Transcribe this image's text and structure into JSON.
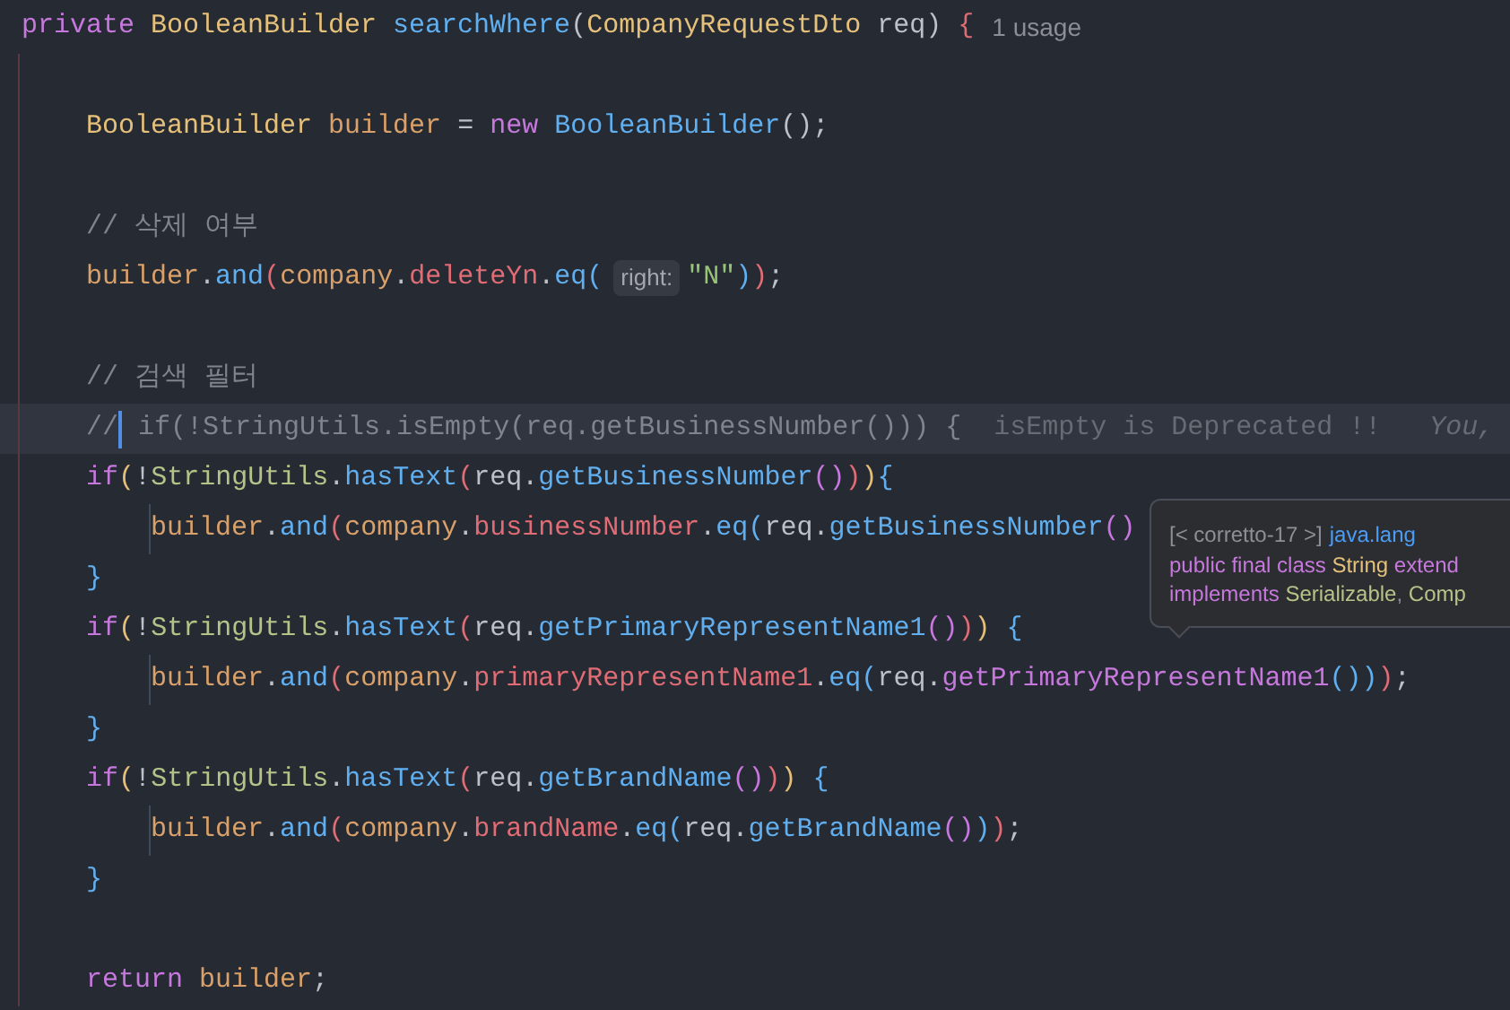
{
  "editor": {
    "lines": [
      {
        "kind": "code",
        "current": false,
        "parts": [
          {
            "kind": "code",
            "tokens": [
              {
                "text": "private ",
                "kind": "kw"
              },
              {
                "text": "BooleanBuilder ",
                "kind": "type"
              },
              {
                "text": "searchWhere",
                "kind": "fn"
              },
              {
                "text": "(",
                "kind": "txt"
              },
              {
                "text": "CompanyRequestDto",
                "kind": "type"
              },
              {
                "text": " req) ",
                "kind": "txt"
              },
              {
                "text": "{",
                "kind": "p4"
              }
            ]
          },
          {
            "kind": "usage-hint",
            "text": "1 usage"
          }
        ]
      },
      {
        "kind": "blank"
      },
      {
        "kind": "code",
        "current": false,
        "parts": [
          {
            "kind": "code",
            "tokens": [
              {
                "text": "    BooleanBuilder ",
                "kind": "type"
              },
              {
                "text": "builder",
                "kind": "var"
              },
              {
                "text": " = ",
                "kind": "txt"
              },
              {
                "text": "new ",
                "kind": "kw"
              },
              {
                "text": "BooleanBuilder",
                "kind": "fn"
              },
              {
                "text": "();",
                "kind": "txt"
              }
            ]
          }
        ]
      },
      {
        "kind": "blank"
      },
      {
        "kind": "code",
        "current": false,
        "parts": [
          {
            "kind": "code",
            "tokens": [
              {
                "text": "    // 삭제 여부",
                "kind": "cmt"
              }
            ]
          }
        ]
      },
      {
        "kind": "code",
        "current": false,
        "parts": [
          {
            "kind": "code",
            "tokens": [
              {
                "text": "    builder",
                "kind": "var"
              },
              {
                "text": ".",
                "kind": "txt"
              },
              {
                "text": "and",
                "kind": "fn"
              },
              {
                "text": "(",
                "kind": "p4"
              },
              {
                "text": "company",
                "kind": "var"
              },
              {
                "text": ".",
                "kind": "txt"
              },
              {
                "text": "deleteYn",
                "kind": "prop"
              },
              {
                "text": ".",
                "kind": "txt"
              },
              {
                "text": "eq",
                "kind": "fn"
              },
              {
                "text": "(",
                "kind": "p3"
              }
            ]
          },
          {
            "kind": "param-hint",
            "text": "right:"
          },
          {
            "kind": "code",
            "tokens": [
              {
                "text": "\"N\"",
                "kind": "str"
              },
              {
                "text": ")",
                "kind": "p3"
              },
              {
                "text": ")",
                "kind": "p4"
              },
              {
                "text": ";",
                "kind": "txt"
              }
            ]
          }
        ]
      },
      {
        "kind": "blank"
      },
      {
        "kind": "code",
        "current": false,
        "parts": [
          {
            "kind": "code",
            "tokens": [
              {
                "text": "    // 검색 필터",
                "kind": "cmt"
              }
            ]
          }
        ]
      },
      {
        "kind": "code",
        "current": true,
        "parts": [
          {
            "kind": "code",
            "tokens": [
              {
                "text": "    //",
                "kind": "cmt"
              }
            ]
          },
          {
            "kind": "caret"
          },
          {
            "kind": "code",
            "tokens": [
              {
                "text": " if(!StringUtils.isEmpty(req.getBusinessNumber())) {",
                "kind": "cmt"
              }
            ]
          },
          {
            "kind": "blame",
            "text": "isEmpty is Deprecated !!   *You,*"
          }
        ]
      },
      {
        "kind": "code",
        "current": false,
        "parts": [
          {
            "kind": "code",
            "tokens": [
              {
                "text": "    if",
                "kind": "kw"
              },
              {
                "text": "(",
                "kind": "p1"
              },
              {
                "text": "!",
                "kind": "txt"
              },
              {
                "text": "StringUtils",
                "kind": "cls"
              },
              {
                "text": ".",
                "kind": "txt"
              },
              {
                "text": "hasText",
                "kind": "fn"
              },
              {
                "text": "(",
                "kind": "p4"
              },
              {
                "text": "req",
                "kind": "txt"
              },
              {
                "text": ".",
                "kind": "txt"
              },
              {
                "text": "getBusinessNumber",
                "kind": "fn"
              },
              {
                "text": "()",
                "kind": "p2"
              },
              {
                "text": ")",
                "kind": "p4"
              },
              {
                "text": ")",
                "kind": "p1"
              },
              {
                "text": "{",
                "kind": "p3"
              }
            ]
          }
        ]
      },
      {
        "kind": "code",
        "current": false,
        "parts": [
          {
            "kind": "code",
            "tokens": [
              {
                "text": "        builder",
                "kind": "var"
              },
              {
                "text": ".",
                "kind": "txt"
              },
              {
                "text": "and",
                "kind": "fn"
              },
              {
                "text": "(",
                "kind": "p4"
              },
              {
                "text": "company",
                "kind": "var"
              },
              {
                "text": ".",
                "kind": "txt"
              },
              {
                "text": "businessNumber",
                "kind": "prop"
              },
              {
                "text": ".",
                "kind": "txt"
              },
              {
                "text": "eq",
                "kind": "fn"
              },
              {
                "text": "(",
                "kind": "p3"
              },
              {
                "text": "req",
                "kind": "txt"
              },
              {
                "text": ".",
                "kind": "txt"
              },
              {
                "text": "getBusinessNumber",
                "kind": "fn"
              },
              {
                "text": "()",
                "kind": "p2"
              }
            ]
          }
        ]
      },
      {
        "kind": "code",
        "current": false,
        "parts": [
          {
            "kind": "code",
            "tokens": [
              {
                "text": "    }",
                "kind": "p3"
              }
            ]
          }
        ]
      },
      {
        "kind": "code",
        "current": false,
        "parts": [
          {
            "kind": "code",
            "tokens": [
              {
                "text": "    if",
                "kind": "kw"
              },
              {
                "text": "(",
                "kind": "p1"
              },
              {
                "text": "!",
                "kind": "txt"
              },
              {
                "text": "StringUtils",
                "kind": "cls"
              },
              {
                "text": ".",
                "kind": "txt"
              },
              {
                "text": "hasText",
                "kind": "fn"
              },
              {
                "text": "(",
                "kind": "p4"
              },
              {
                "text": "req",
                "kind": "txt"
              },
              {
                "text": ".",
                "kind": "txt"
              },
              {
                "text": "getPrimaryRepresentName1",
                "kind": "fn"
              },
              {
                "text": "()",
                "kind": "p2"
              },
              {
                "text": ")",
                "kind": "p4"
              },
              {
                "text": ")",
                "kind": "p1"
              },
              {
                "text": " {",
                "kind": "p3"
              }
            ]
          }
        ]
      },
      {
        "kind": "code",
        "current": false,
        "parts": [
          {
            "kind": "code",
            "tokens": [
              {
                "text": "        builder",
                "kind": "var"
              },
              {
                "text": ".",
                "kind": "txt"
              },
              {
                "text": "and",
                "kind": "fn"
              },
              {
                "text": "(",
                "kind": "p4"
              },
              {
                "text": "company",
                "kind": "var"
              },
              {
                "text": ".",
                "kind": "txt"
              },
              {
                "text": "primaryRepresentName1",
                "kind": "prop"
              },
              {
                "text": ".",
                "kind": "txt"
              },
              {
                "text": "eq",
                "kind": "fn"
              },
              {
                "text": "(",
                "kind": "p3"
              },
              {
                "text": "req",
                "kind": "txt"
              },
              {
                "text": ".",
                "kind": "txt"
              },
              {
                "text": "getPrimaryRepresentName1",
                "kind": "fn2"
              },
              {
                "text": "()",
                "kind": "p3"
              },
              {
                "text": ")",
                "kind": "p3"
              },
              {
                "text": ")",
                "kind": "p4"
              },
              {
                "text": ";",
                "kind": "txt"
              }
            ]
          }
        ]
      },
      {
        "kind": "code",
        "current": false,
        "parts": [
          {
            "kind": "code",
            "tokens": [
              {
                "text": "    }",
                "kind": "p3"
              }
            ]
          }
        ]
      },
      {
        "kind": "code",
        "current": false,
        "parts": [
          {
            "kind": "code",
            "tokens": [
              {
                "text": "    if",
                "kind": "kw"
              },
              {
                "text": "(",
                "kind": "p1"
              },
              {
                "text": "!",
                "kind": "txt"
              },
              {
                "text": "StringUtils",
                "kind": "cls"
              },
              {
                "text": ".",
                "kind": "txt"
              },
              {
                "text": "hasText",
                "kind": "fn"
              },
              {
                "text": "(",
                "kind": "p4"
              },
              {
                "text": "req",
                "kind": "txt"
              },
              {
                "text": ".",
                "kind": "txt"
              },
              {
                "text": "getBrandName",
                "kind": "fn"
              },
              {
                "text": "()",
                "kind": "p2"
              },
              {
                "text": ")",
                "kind": "p4"
              },
              {
                "text": ")",
                "kind": "p1"
              },
              {
                "text": " {",
                "kind": "p3"
              }
            ]
          }
        ]
      },
      {
        "kind": "code",
        "current": false,
        "parts": [
          {
            "kind": "code",
            "tokens": [
              {
                "text": "        builder",
                "kind": "var"
              },
              {
                "text": ".",
                "kind": "txt"
              },
              {
                "text": "and",
                "kind": "fn"
              },
              {
                "text": "(",
                "kind": "p4"
              },
              {
                "text": "company",
                "kind": "var"
              },
              {
                "text": ".",
                "kind": "txt"
              },
              {
                "text": "brandName",
                "kind": "prop"
              },
              {
                "text": ".",
                "kind": "txt"
              },
              {
                "text": "eq",
                "kind": "fn"
              },
              {
                "text": "(",
                "kind": "p3"
              },
              {
                "text": "req",
                "kind": "txt"
              },
              {
                "text": ".",
                "kind": "txt"
              },
              {
                "text": "getBrandName",
                "kind": "fn"
              },
              {
                "text": "()",
                "kind": "p2"
              },
              {
                "text": ")",
                "kind": "p3"
              },
              {
                "text": ")",
                "kind": "p4"
              },
              {
                "text": ";",
                "kind": "txt"
              }
            ]
          }
        ]
      },
      {
        "kind": "code",
        "current": false,
        "parts": [
          {
            "kind": "code",
            "tokens": [
              {
                "text": "    }",
                "kind": "p3"
              }
            ]
          }
        ]
      },
      {
        "kind": "blank"
      },
      {
        "kind": "code",
        "current": false,
        "parts": [
          {
            "kind": "code",
            "tokens": [
              {
                "text": "    return ",
                "kind": "kw"
              },
              {
                "text": "builder",
                "kind": "var"
              },
              {
                "text": ";",
                "kind": "txt"
              }
            ]
          }
        ]
      }
    ]
  },
  "popup": {
    "lines": [
      {
        "tokens": [
          {
            "text": "[< corretto-17 >]",
            "kind": "muted"
          }
        ],
        "link": "java.lang"
      },
      {
        "tokens": [
          {
            "text": "public final class ",
            "kind": "kw"
          },
          {
            "text": "String",
            "kind": "type"
          },
          {
            "text": " extend",
            "kind": "kw"
          }
        ]
      },
      {
        "tokens": [
          {
            "text": "implements ",
            "kind": "kw"
          },
          {
            "text": "Serializable",
            "kind": "cls"
          },
          {
            "text": ", ",
            "kind": "muted"
          },
          {
            "text": "Comp",
            "kind": "cls"
          }
        ]
      }
    ]
  }
}
